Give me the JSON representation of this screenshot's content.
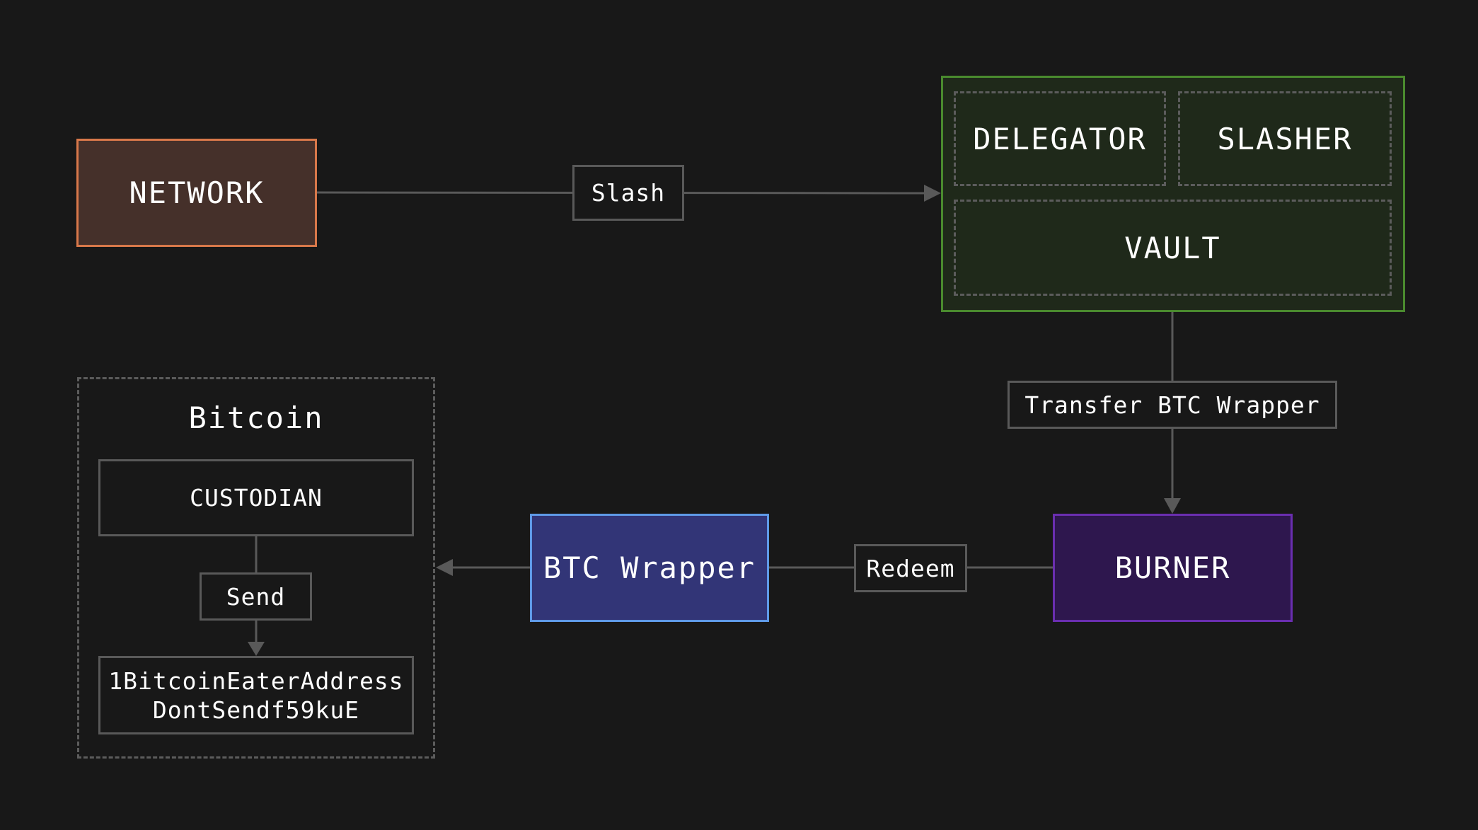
{
  "diagram": {
    "background": "#181818",
    "nodes": {
      "network": {
        "label": "NETWORK",
        "fill": "#45302a",
        "border": "#d8784a"
      },
      "vault_group": {
        "fill": "#1f291a",
        "border": "#4a8a2e"
      },
      "delegator": {
        "label": "DELEGATOR"
      },
      "slasher": {
        "label": "SLASHER"
      },
      "vault": {
        "label": "VAULT"
      },
      "burner": {
        "label": "BURNER",
        "fill": "#2e174e",
        "border": "#6a2eb0"
      },
      "btc_wrapper": {
        "label": "BTC Wrapper",
        "fill": "#323577",
        "border": "#5f9ae8"
      },
      "bitcoin_group": {
        "label": "Bitcoin"
      },
      "custodian": {
        "label": "CUSTODIAN"
      },
      "address": {
        "label": "1BitcoinEaterAddress\nDontSendf59kuE"
      }
    },
    "edges": [
      {
        "from": "network",
        "to": "vault_group",
        "label": "Slash"
      },
      {
        "from": "vault",
        "to": "burner",
        "label": "Transfer BTC Wrapper"
      },
      {
        "from": "burner",
        "to": "btc_wrapper",
        "label": "Redeem"
      },
      {
        "from": "btc_wrapper",
        "to": "bitcoin_group",
        "label": ""
      },
      {
        "from": "custodian",
        "to": "address",
        "label": "Send"
      }
    ],
    "edge_color": "#595959"
  }
}
